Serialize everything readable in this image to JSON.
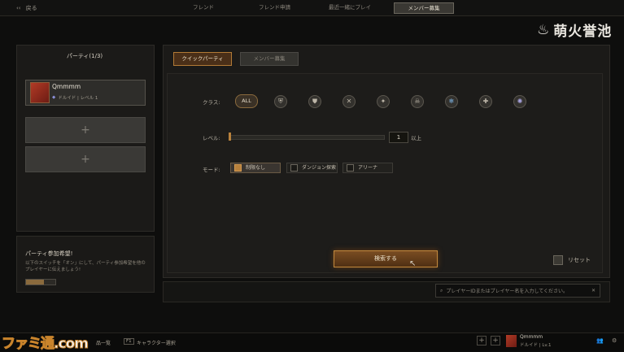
{
  "topbar": {
    "back_label": "戻る",
    "tabs": [
      {
        "label": "フレンド"
      },
      {
        "label": "フレンド申請"
      },
      {
        "label": "最近一緒にプレイ"
      },
      {
        "label": "メンバー募集"
      }
    ]
  },
  "logo": {
    "text": "萌火誉池"
  },
  "party": {
    "title": "パーティ(1/3)",
    "member": {
      "name": "Qmmmm",
      "class_level": "ドルイド | レベル 1"
    },
    "empty_slot_symbol": "+"
  },
  "recruit_hint": {
    "title": "パーティ参加希望!",
    "text": "以下のスイッチを「オン」にして、パーティ参加希望を他のプレイヤーに伝えましょう!"
  },
  "subtabs": {
    "quick": "クイックパーティ",
    "member": "メンバー募集"
  },
  "filters": {
    "class_label": "クラス:",
    "class_all": "ALL",
    "class_icons": [
      "barbarian-icon",
      "druid-icon",
      "rogue-icon",
      "sorcerer-icon",
      "necromancer-icon",
      "frost-icon",
      "spiritborn-icon",
      "paladin-icon"
    ],
    "level_label": "レベル:",
    "level_value": "1",
    "level_suffix": "以上",
    "mode_label": "モード:",
    "modes": [
      {
        "label": "制限なし",
        "selected": true
      },
      {
        "label": "ダンジョン探索",
        "selected": false
      },
      {
        "label": "アリーナ",
        "selected": false
      }
    ]
  },
  "actions": {
    "search": "検索する",
    "reset": "リセット"
  },
  "id_search": {
    "placeholder": "プレイヤーIDまたはプレイヤー名を入力してください。"
  },
  "footer": {
    "left_text": "品一覧",
    "key_f1": "F1",
    "char_select": "キャラクター選択",
    "profile_name": "Qmmmm",
    "profile_class": "ドルイド | Lv.1"
  },
  "watermark": {
    "text": "ファミ通.com"
  },
  "colors": {
    "accent": "#b8813c",
    "background": "#0e0e0d"
  }
}
